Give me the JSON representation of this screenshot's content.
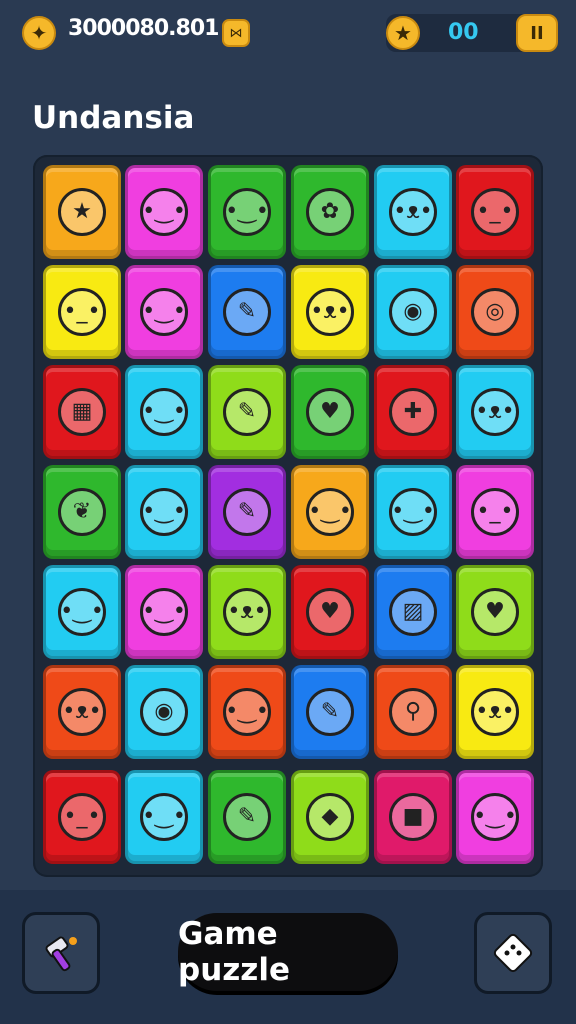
{
  "header": {
    "score": "3000080.801",
    "stars": "00",
    "pause_label": "II"
  },
  "title": "Undansia",
  "board": {
    "rows": [
      [
        {
          "color": "#f7a81b",
          "icon": "star-face-icon",
          "glyph": "★"
        },
        {
          "color": "#f03ee0",
          "icon": "green-face-icon",
          "glyph": "•‿•"
        },
        {
          "color": "#2fb82d",
          "icon": "green-critter-icon",
          "glyph": "•‿•"
        },
        {
          "color": "#2fb82d",
          "icon": "pink-flower-icon",
          "glyph": "✿"
        },
        {
          "color": "#22ccf2",
          "icon": "pink-cat-icon",
          "glyph": "•ᴥ•"
        },
        {
          "color": "#e0171d",
          "icon": "white-robot-icon",
          "glyph": "•_•"
        }
      ],
      [
        {
          "color": "#f8ea12",
          "icon": "gray-face-icon",
          "glyph": "•_•"
        },
        {
          "color": "#f03ee0",
          "icon": "yellow-face-icon",
          "glyph": "•‿•"
        },
        {
          "color": "#1d7cf0",
          "icon": "pencil-icon",
          "glyph": "✎"
        },
        {
          "color": "#f8ea12",
          "icon": "orange-cat-icon",
          "glyph": "•ᴥ•"
        },
        {
          "color": "#22ccf2",
          "icon": "ice-cream-icon",
          "glyph": "◉"
        },
        {
          "color": "#ef4a18",
          "icon": "lollipop-icon",
          "glyph": "◎"
        }
      ],
      [
        {
          "color": "#e0171d",
          "icon": "calendar-icon",
          "glyph": "▦"
        },
        {
          "color": "#22ccf2",
          "icon": "green-monster-icon",
          "glyph": "•‿•"
        },
        {
          "color": "#8fdc1a",
          "icon": "crayon-icon",
          "glyph": "✎"
        },
        {
          "color": "#2fb82d",
          "icon": "blue-heart-icon",
          "glyph": "♥"
        },
        {
          "color": "#e0171d",
          "icon": "pushpin-icon",
          "glyph": "✚"
        },
        {
          "color": "#22ccf2",
          "icon": "green-cat-icon",
          "glyph": "•ᴥ•"
        }
      ],
      [
        {
          "color": "#2fb82d",
          "icon": "yellow-leaf-icon",
          "glyph": "❦"
        },
        {
          "color": "#22ccf2",
          "icon": "green-fish-icon",
          "glyph": "•‿•"
        },
        {
          "color": "#a22ee0",
          "icon": "pink-crayon-icon",
          "glyph": "✎"
        },
        {
          "color": "#f7a81b",
          "icon": "brown-face-icon",
          "glyph": "•‿•"
        },
        {
          "color": "#22ccf2",
          "icon": "yellow-face-icon",
          "glyph": "•‿•"
        },
        {
          "color": "#f03ee0",
          "icon": "orange-face-icon",
          "glyph": "•_•"
        }
      ],
      [
        {
          "color": "#22ccf2",
          "icon": "pink-ghost-icon",
          "glyph": "•‿•"
        },
        {
          "color": "#f03ee0",
          "icon": "yellow-drop-icon",
          "glyph": "•‿•"
        },
        {
          "color": "#8fdc1a",
          "icon": "tan-cat-icon",
          "glyph": "•ᴥ•"
        },
        {
          "color": "#e0171d",
          "icon": "red-heart-icon",
          "glyph": "♥"
        },
        {
          "color": "#1d7cf0",
          "icon": "purple-box-icon",
          "glyph": "▨"
        },
        {
          "color": "#8fdc1a",
          "icon": "yellow-heart-icon",
          "glyph": "♥"
        }
      ],
      [
        {
          "color": "#ef4a18",
          "icon": "orange-cat-icon",
          "glyph": "•ᴥ•"
        },
        {
          "color": "#22ccf2",
          "icon": "drumstick-icon",
          "glyph": "◉"
        },
        {
          "color": "#ef4a18",
          "icon": "white-face-icon",
          "glyph": "•‿•"
        },
        {
          "color": "#1d7cf0",
          "icon": "pink-crayon-icon",
          "glyph": "✎"
        },
        {
          "color": "#ef4a18",
          "icon": "magnifier-icon",
          "glyph": "⚲"
        },
        {
          "color": "#f8ea12",
          "icon": "green-cat-icon",
          "glyph": "•ᴥ•"
        }
      ],
      [
        {
          "color": "#e0171d",
          "icon": "gray-face-icon",
          "glyph": "•_•"
        },
        {
          "color": "#22ccf2",
          "icon": "yellow-face-icon",
          "glyph": "•‿•"
        },
        {
          "color": "#2fb82d",
          "icon": "pencil-icon",
          "glyph": "✎"
        },
        {
          "color": "#8fdc1a",
          "icon": "candy-icon",
          "glyph": "◆"
        },
        {
          "color": "#e01a6a",
          "icon": "yellow-square-icon",
          "glyph": "■"
        },
        {
          "color": "#f03ee0",
          "icon": "blue-ghost-icon",
          "glyph": "•‿•"
        }
      ]
    ]
  },
  "bottom": {
    "game_button_label": "Game puzzle"
  }
}
